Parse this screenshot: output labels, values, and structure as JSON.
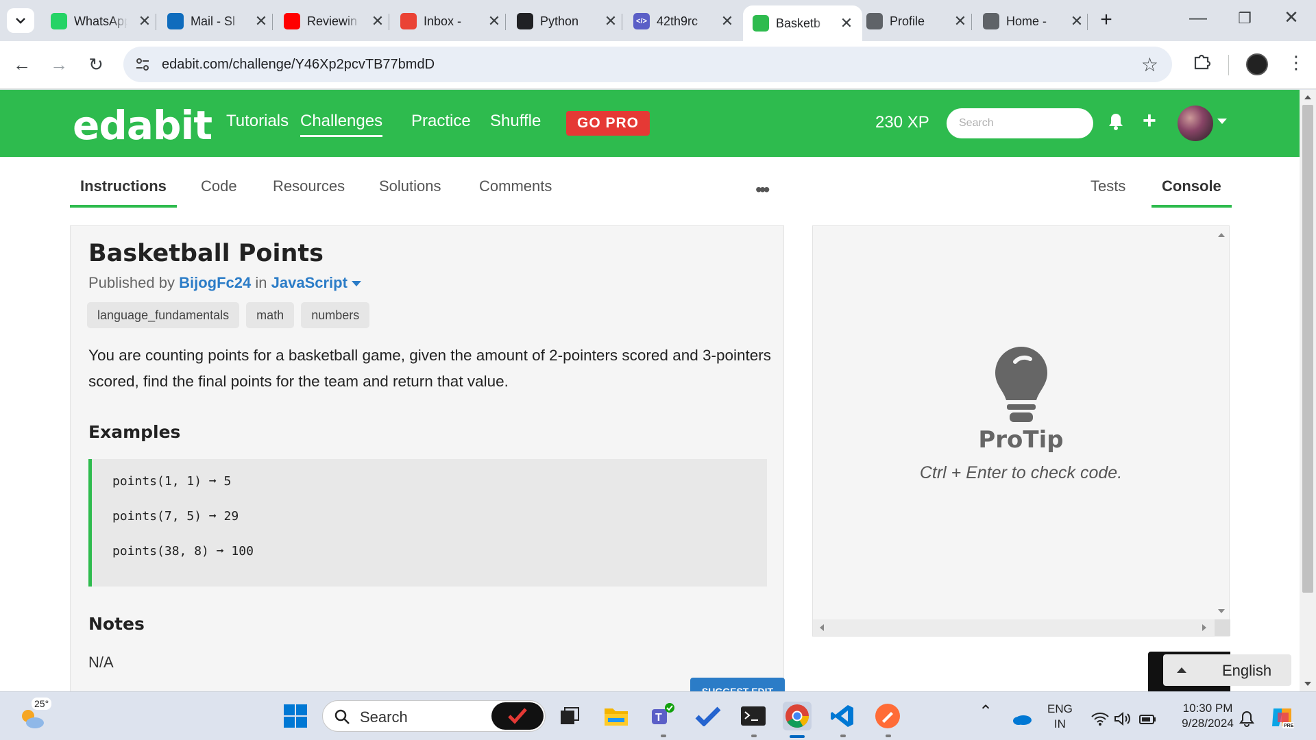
{
  "browser": {
    "tabs": [
      {
        "label": "WhatsApp",
        "icon": "whatsapp-icon",
        "color": "#25d366"
      },
      {
        "label": "Mail - Sl",
        "icon": "outlook-icon",
        "color": "#0f6cbd"
      },
      {
        "label": "Reviewin",
        "icon": "youtube-icon",
        "color": "#ff0000"
      },
      {
        "label": "Inbox - ",
        "icon": "gmail-icon",
        "color": "#ea4335"
      },
      {
        "label": "Python",
        "icon": "openai-icon",
        "color": "#202124"
      },
      {
        "label": "42th9rc",
        "icon": "code-icon",
        "color": "#5b5fc7"
      },
      {
        "label": "Basketb",
        "icon": "edabit-favicon-icon",
        "color": "#2ebb4e"
      },
      {
        "label": "Profile ",
        "icon": "globe-icon",
        "color": "#5f6368"
      },
      {
        "label": "Home - ",
        "icon": "globe-icon",
        "color": "#5f6368"
      }
    ],
    "active_tab": 6,
    "url": "edabit.com/challenge/Y46Xp2pcvTB77bmdD"
  },
  "site": {
    "logo": "edabit",
    "nav": [
      "Tutorials",
      "Challenges",
      "Practice",
      "Shuffle"
    ],
    "active_nav": "Challenges",
    "gopro": "GO PRO",
    "xp": "230 XP",
    "search_placeholder": "Search",
    "brand_color": "#2ebb4e"
  },
  "subtabs": {
    "left": [
      "Instructions",
      "Code",
      "Resources",
      "Solutions",
      "Comments"
    ],
    "right": [
      "Tests",
      "Console"
    ],
    "more": "•••"
  },
  "challenge": {
    "title": "Basketball Points",
    "published_by_prefix": "Published by",
    "author": "BijogFc24",
    "in_word": "in",
    "language": "JavaScript",
    "tags": [
      "language_fundamentals",
      "math",
      "numbers"
    ],
    "description": "You are counting points for a basketball game, given the amount of 2-pointers scored and 3-pointers scored, find the final points for the team and return that value.",
    "examples_heading": "Examples",
    "examples": [
      "points(1, 1) ➞ 5",
      "points(7, 5) ➞ 29",
      "points(38, 8) ➞ 100"
    ],
    "notes_heading": "Notes",
    "notes": "N/A",
    "suggest_edit": "SUGGEST EDIT"
  },
  "console": {
    "protip_title": "ProTip",
    "protip_text": "Ctrl + Enter to check code.",
    "language": "English"
  },
  "taskbar": {
    "weather": "25°",
    "search_placeholder": "Search",
    "lang_top": "ENG",
    "lang_bottom": "IN",
    "time": "10:30 PM",
    "date": "9/28/2024"
  }
}
